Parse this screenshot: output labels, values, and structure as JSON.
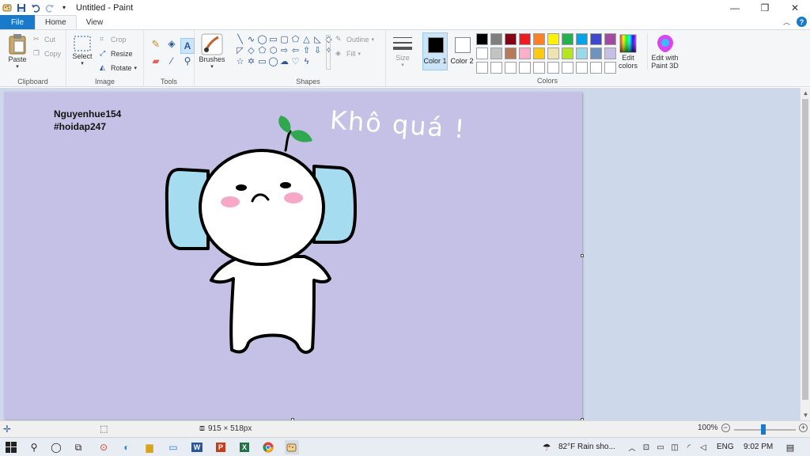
{
  "window": {
    "title": "Untitled - Paint",
    "tabs": [
      {
        "label": "File"
      },
      {
        "label": "Home"
      },
      {
        "label": "View"
      }
    ]
  },
  "ribbon": {
    "clipboard": {
      "label": "Clipboard",
      "paste": "Paste",
      "cut": "Cut",
      "copy": "Copy"
    },
    "image": {
      "label": "Image",
      "select": "Select",
      "crop": "Crop",
      "resize": "Resize",
      "rotate": "Rotate"
    },
    "tools": {
      "label": "Tools"
    },
    "brushes": {
      "label": "Brushes"
    },
    "shapes": {
      "label": "Shapes",
      "outline": "Outline",
      "fill": "Fill"
    },
    "size": {
      "label": "Size"
    },
    "color1": {
      "label": "Color 1",
      "value": "#000000"
    },
    "color2": {
      "label": "Color 2",
      "value": "#ffffff"
    },
    "colors": {
      "label": "Colors"
    },
    "edit_colors": "Edit colors",
    "edit_paint3d": "Edit with Paint 3D",
    "palette": [
      "#000000",
      "#7f7f7f",
      "#880015",
      "#ed1c24",
      "#ff7f27",
      "#fff200",
      "#22b14c",
      "#00a2e8",
      "#3f48cc",
      "#a349a4",
      "#ffffff",
      "#c3c3c3",
      "#b97a57",
      "#ffaec9",
      "#ffc90e",
      "#efe4b0",
      "#b5e61d",
      "#99d9ea",
      "#7092be",
      "#c8bfe7",
      "#ffffff",
      "#ffffff",
      "#ffffff",
      "#ffffff",
      "#ffffff",
      "#ffffff",
      "#ffffff",
      "#ffffff",
      "#ffffff",
      "#ffffff"
    ]
  },
  "canvas": {
    "background": "#c5c1e6",
    "signature_line1": "Nguyenhue154",
    "signature_line2": "#hoidap247",
    "handwritten_text": "Khô quá !"
  },
  "status": {
    "image_size": "915 × 518px",
    "zoom": "100%"
  },
  "taskbar": {
    "weather": "82°F  Rain sho...",
    "language": "ENG",
    "time": "9:02 PM"
  }
}
